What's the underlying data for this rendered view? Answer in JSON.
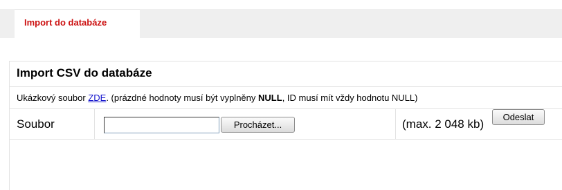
{
  "tabs": [
    {
      "label": "Import do databáze"
    }
  ],
  "form": {
    "title": "Import CSV do databáze",
    "info": {
      "prefix": "Ukázkový soubor ",
      "link": "ZDE",
      "middle": ". (prázdné hodnoty musí být vyplněny ",
      "bold": "NULL",
      "suffix": ", ID musí mít vždy hodnotu NULL)"
    },
    "file_label": "Soubor",
    "file_value": "",
    "browse_label": "Procházet...",
    "max_size": "(max. 2 048 kb)",
    "submit_label": "Odeslat"
  }
}
